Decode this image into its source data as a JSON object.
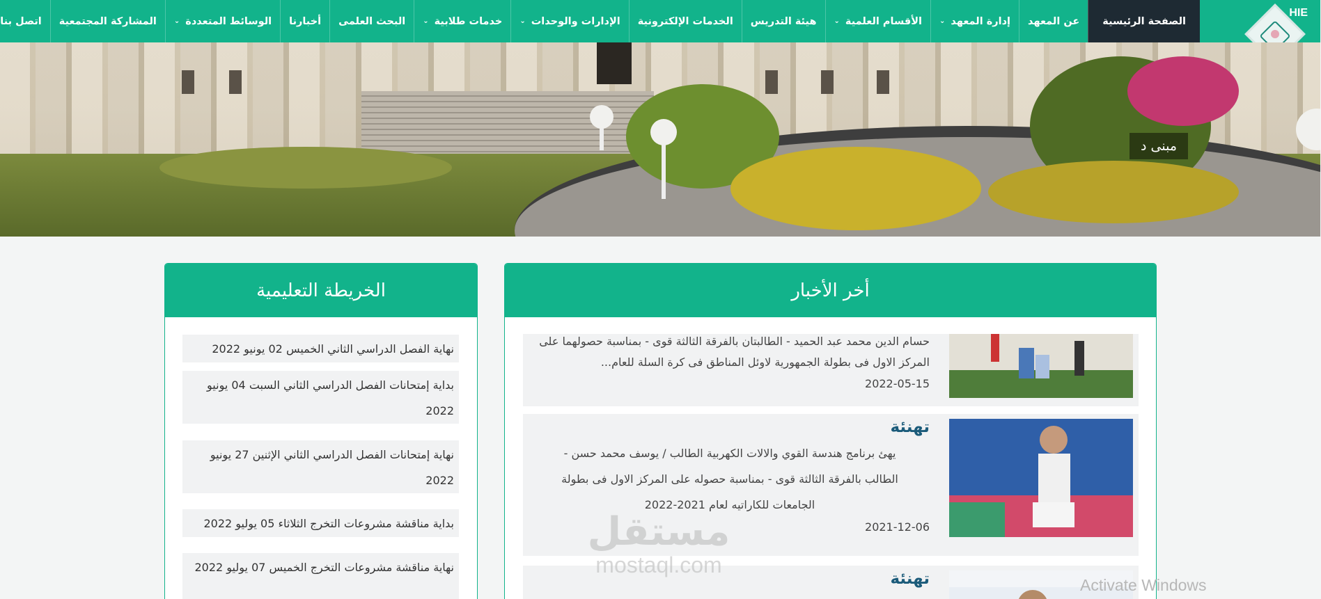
{
  "nav": {
    "items": [
      {
        "label": "الصفحة الرئيسية",
        "active": true,
        "dropdown": false
      },
      {
        "label": "عن المعهد",
        "active": false,
        "dropdown": false
      },
      {
        "label": "إدارة المعهد",
        "active": false,
        "dropdown": true
      },
      {
        "label": "الأقسام العلمية",
        "active": false,
        "dropdown": true
      },
      {
        "label": "هيئة التدريس",
        "active": false,
        "dropdown": false
      },
      {
        "label": "الخدمات الإلكترونية",
        "active": false,
        "dropdown": false
      },
      {
        "label": "الإدارات والوحدات",
        "active": false,
        "dropdown": true
      },
      {
        "label": "خدمات طلابية",
        "active": false,
        "dropdown": true
      },
      {
        "label": "البحث العلمى",
        "active": false,
        "dropdown": false
      },
      {
        "label": "أخبارنا",
        "active": false,
        "dropdown": false
      },
      {
        "label": "الوسائط المتعددة",
        "active": false,
        "dropdown": true
      },
      {
        "label": "المشاركة المجتمعية",
        "active": false,
        "dropdown": false
      },
      {
        "label": "اتصل بنا",
        "active": false,
        "dropdown": false
      }
    ],
    "logo_badge": "HIE"
  },
  "hero": {
    "caption": "مبنى د"
  },
  "news": {
    "title": "أخر الأخبار",
    "items": [
      {
        "title": "",
        "text": "حسام الدين محمد عبد الحميد - الطالبتان بالفرقة الثالثة قوى - بمناسبة حصولهما على المركز الاول فى بطولة الجمهورية لاوئل المناطق فى كرة السلة للعام...",
        "date": "2022-05-15"
      },
      {
        "title": "تهنئة",
        "text": "يهئ برنامج هندسة القوي والالات الكهربية الطالب / يوسف محمد حسن - الطالب بالفرقة الثالثة قوى - بمناسبة حصوله على المركز الاول فى بطولة الجامعات للكاراتيه لعام 2021-2022",
        "date": "2021-12-06"
      },
      {
        "title": "تهنئة",
        "text": "",
        "date": ""
      }
    ]
  },
  "edu_map": {
    "title": "الخريطة التعليمية",
    "items": [
      "نهاية الفصل الدراسي الثاني الخميس 02 يونيو 2022",
      "بداية إمتحانات الفصل الدراسي الثاني السبت 04 يونيو 2022",
      "نهاية إمتحانات الفصل الدراسي الثاني الإثنين 27 يونيو 2022",
      "بداية مناقشة مشروعات التخرج الثلاثاء 05 يوليو 2022",
      "نهاية مناقشة مشروعات التخرج الخميس 07 يوليو 2022"
    ]
  },
  "watermark": {
    "arabic": "مستقل",
    "latin": "mostaql.com"
  },
  "os_notice": "Activate Windows",
  "colors": {
    "brand": "#12b38b",
    "active_nav": "#1e2a33",
    "news_title": "#1b5b7a"
  }
}
